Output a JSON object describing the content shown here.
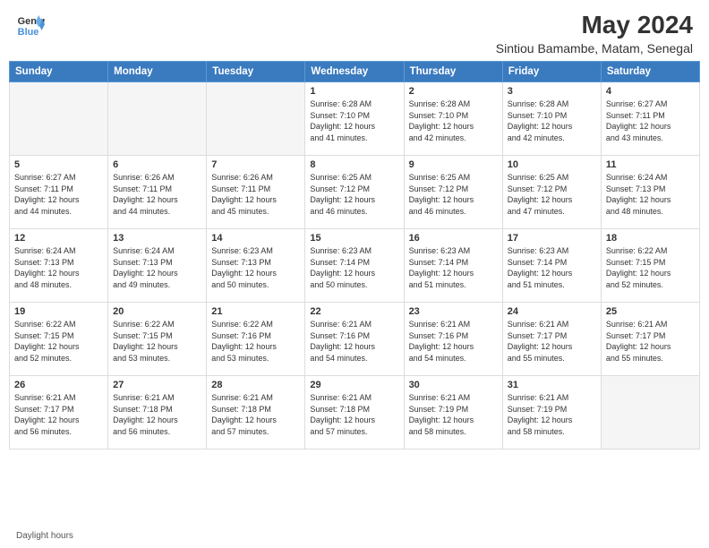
{
  "header": {
    "logo_line1": "General",
    "logo_line2": "Blue",
    "title": "May 2024",
    "subtitle": "Sintiou Bamambe, Matam, Senegal"
  },
  "days_of_week": [
    "Sunday",
    "Monday",
    "Tuesday",
    "Wednesday",
    "Thursday",
    "Friday",
    "Saturday"
  ],
  "weeks": [
    [
      {
        "num": "",
        "info": ""
      },
      {
        "num": "",
        "info": ""
      },
      {
        "num": "",
        "info": ""
      },
      {
        "num": "1",
        "info": "Sunrise: 6:28 AM\nSunset: 7:10 PM\nDaylight: 12 hours\nand 41 minutes."
      },
      {
        "num": "2",
        "info": "Sunrise: 6:28 AM\nSunset: 7:10 PM\nDaylight: 12 hours\nand 42 minutes."
      },
      {
        "num": "3",
        "info": "Sunrise: 6:28 AM\nSunset: 7:10 PM\nDaylight: 12 hours\nand 42 minutes."
      },
      {
        "num": "4",
        "info": "Sunrise: 6:27 AM\nSunset: 7:11 PM\nDaylight: 12 hours\nand 43 minutes."
      }
    ],
    [
      {
        "num": "5",
        "info": "Sunrise: 6:27 AM\nSunset: 7:11 PM\nDaylight: 12 hours\nand 44 minutes."
      },
      {
        "num": "6",
        "info": "Sunrise: 6:26 AM\nSunset: 7:11 PM\nDaylight: 12 hours\nand 44 minutes."
      },
      {
        "num": "7",
        "info": "Sunrise: 6:26 AM\nSunset: 7:11 PM\nDaylight: 12 hours\nand 45 minutes."
      },
      {
        "num": "8",
        "info": "Sunrise: 6:25 AM\nSunset: 7:12 PM\nDaylight: 12 hours\nand 46 minutes."
      },
      {
        "num": "9",
        "info": "Sunrise: 6:25 AM\nSunset: 7:12 PM\nDaylight: 12 hours\nand 46 minutes."
      },
      {
        "num": "10",
        "info": "Sunrise: 6:25 AM\nSunset: 7:12 PM\nDaylight: 12 hours\nand 47 minutes."
      },
      {
        "num": "11",
        "info": "Sunrise: 6:24 AM\nSunset: 7:13 PM\nDaylight: 12 hours\nand 48 minutes."
      }
    ],
    [
      {
        "num": "12",
        "info": "Sunrise: 6:24 AM\nSunset: 7:13 PM\nDaylight: 12 hours\nand 48 minutes."
      },
      {
        "num": "13",
        "info": "Sunrise: 6:24 AM\nSunset: 7:13 PM\nDaylight: 12 hours\nand 49 minutes."
      },
      {
        "num": "14",
        "info": "Sunrise: 6:23 AM\nSunset: 7:13 PM\nDaylight: 12 hours\nand 50 minutes."
      },
      {
        "num": "15",
        "info": "Sunrise: 6:23 AM\nSunset: 7:14 PM\nDaylight: 12 hours\nand 50 minutes."
      },
      {
        "num": "16",
        "info": "Sunrise: 6:23 AM\nSunset: 7:14 PM\nDaylight: 12 hours\nand 51 minutes."
      },
      {
        "num": "17",
        "info": "Sunrise: 6:23 AM\nSunset: 7:14 PM\nDaylight: 12 hours\nand 51 minutes."
      },
      {
        "num": "18",
        "info": "Sunrise: 6:22 AM\nSunset: 7:15 PM\nDaylight: 12 hours\nand 52 minutes."
      }
    ],
    [
      {
        "num": "19",
        "info": "Sunrise: 6:22 AM\nSunset: 7:15 PM\nDaylight: 12 hours\nand 52 minutes."
      },
      {
        "num": "20",
        "info": "Sunrise: 6:22 AM\nSunset: 7:15 PM\nDaylight: 12 hours\nand 53 minutes."
      },
      {
        "num": "21",
        "info": "Sunrise: 6:22 AM\nSunset: 7:16 PM\nDaylight: 12 hours\nand 53 minutes."
      },
      {
        "num": "22",
        "info": "Sunrise: 6:21 AM\nSunset: 7:16 PM\nDaylight: 12 hours\nand 54 minutes."
      },
      {
        "num": "23",
        "info": "Sunrise: 6:21 AM\nSunset: 7:16 PM\nDaylight: 12 hours\nand 54 minutes."
      },
      {
        "num": "24",
        "info": "Sunrise: 6:21 AM\nSunset: 7:17 PM\nDaylight: 12 hours\nand 55 minutes."
      },
      {
        "num": "25",
        "info": "Sunrise: 6:21 AM\nSunset: 7:17 PM\nDaylight: 12 hours\nand 55 minutes."
      }
    ],
    [
      {
        "num": "26",
        "info": "Sunrise: 6:21 AM\nSunset: 7:17 PM\nDaylight: 12 hours\nand 56 minutes."
      },
      {
        "num": "27",
        "info": "Sunrise: 6:21 AM\nSunset: 7:18 PM\nDaylight: 12 hours\nand 56 minutes."
      },
      {
        "num": "28",
        "info": "Sunrise: 6:21 AM\nSunset: 7:18 PM\nDaylight: 12 hours\nand 57 minutes."
      },
      {
        "num": "29",
        "info": "Sunrise: 6:21 AM\nSunset: 7:18 PM\nDaylight: 12 hours\nand 57 minutes."
      },
      {
        "num": "30",
        "info": "Sunrise: 6:21 AM\nSunset: 7:19 PM\nDaylight: 12 hours\nand 58 minutes."
      },
      {
        "num": "31",
        "info": "Sunrise: 6:21 AM\nSunset: 7:19 PM\nDaylight: 12 hours\nand 58 minutes."
      },
      {
        "num": "",
        "info": ""
      }
    ]
  ],
  "footer": {
    "daylight_label": "Daylight hours"
  }
}
